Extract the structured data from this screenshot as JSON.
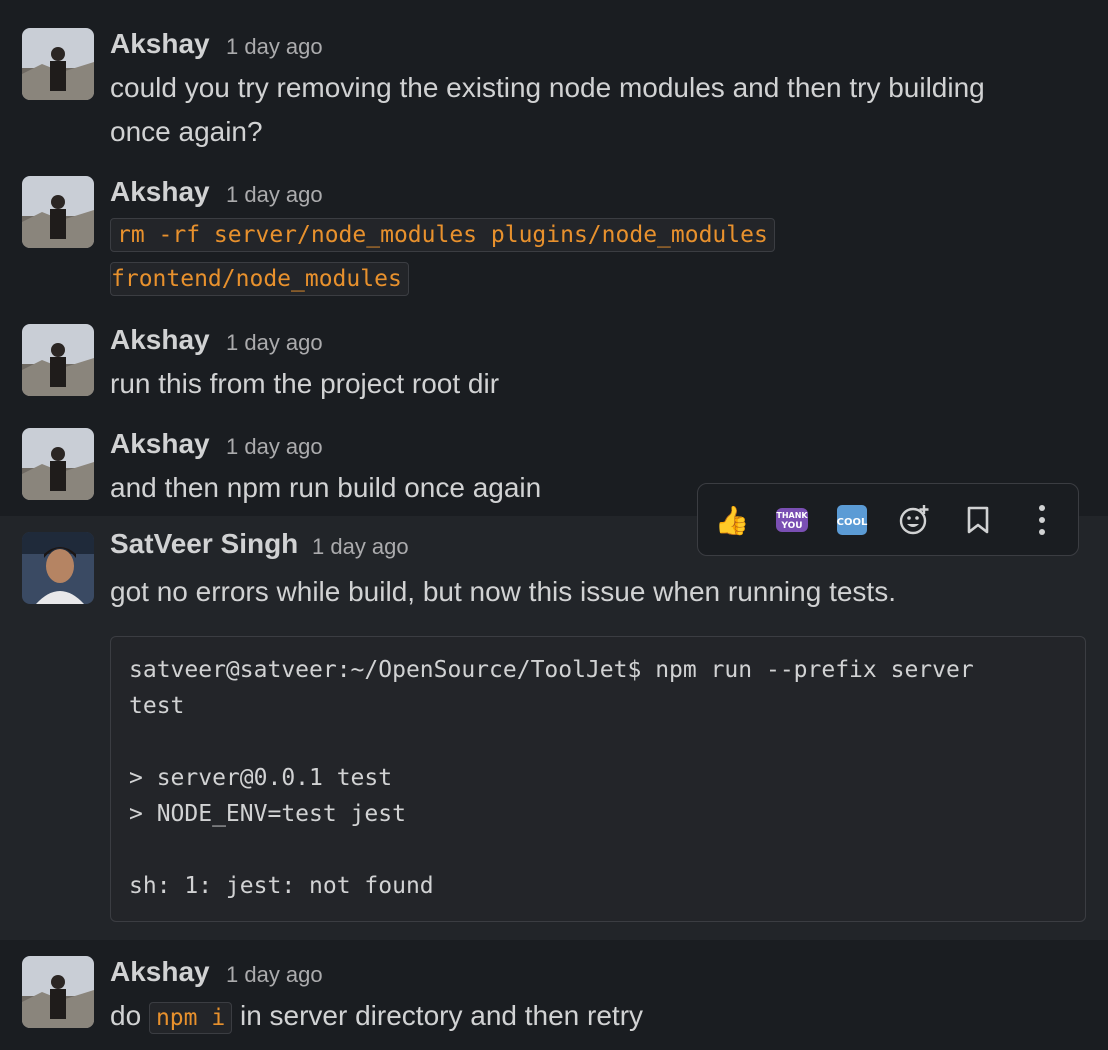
{
  "messages": [
    {
      "author": "Akshay",
      "time": "1 day ago",
      "line1": "could you try removing the existing node modules and then try building",
      "line2": "once again?"
    },
    {
      "author": "Akshay",
      "time": "1 day ago",
      "code1": "rm -rf server/node_modules plugins/node_modules ",
      "code2": "frontend/node_modules"
    },
    {
      "author": "Akshay",
      "time": "1 day ago",
      "text": "run this from the project root dir"
    },
    {
      "author": "Akshay",
      "time": "1 day ago",
      "text": "and then npm run build once again"
    },
    {
      "author": "SatVeer Singh",
      "time": "1 day ago",
      "text": "got no errors while build, but now this issue when running tests.",
      "code_lines": [
        "satveer@satveer:~/OpenSource/ToolJet$ npm run --prefix server",
        "test",
        "",
        "> server@0.0.1 test",
        "> NODE_ENV=test jest",
        "",
        "sh: 1: jest: not found"
      ]
    },
    {
      "author": "Akshay",
      "time": "1 day ago",
      "pre": "do ",
      "inline_code": "npm i",
      "post": " in server directory and then retry"
    }
  ],
  "toolbar": {
    "items": [
      {
        "name": "thumbs-up-reaction",
        "glyph": "👍🏼"
      },
      {
        "name": "thank-you-reaction",
        "glyph": "THANK YOU"
      },
      {
        "name": "cool-reaction",
        "glyph": "COOL"
      },
      {
        "name": "add-reaction",
        "glyph": "☺+"
      },
      {
        "name": "bookmark",
        "glyph": "🔖"
      },
      {
        "name": "more-actions",
        "glyph": "⋮"
      }
    ]
  }
}
